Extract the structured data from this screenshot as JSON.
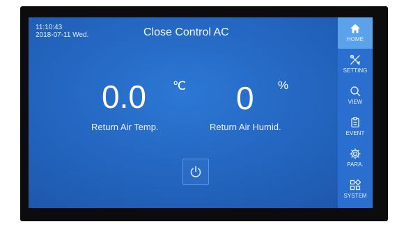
{
  "header": {
    "time": "11:10:43",
    "date": "2018-07-11 Wed.",
    "title": "Close Control AC"
  },
  "readings": {
    "temperature": {
      "value": "0.0",
      "unit": "℃",
      "label": "Return Air Temp."
    },
    "humidity": {
      "value": "0",
      "unit": "%",
      "label": "Return Air Humid."
    }
  },
  "power": {
    "icon": "power-icon"
  },
  "sidebar": {
    "active": "HOME",
    "items": [
      {
        "label": "HOME",
        "icon": "home-icon"
      },
      {
        "label": "SETTING",
        "icon": "tools-icon"
      },
      {
        "label": "VIEW",
        "icon": "search-icon"
      },
      {
        "label": "EVENT",
        "icon": "clipboard-icon"
      },
      {
        "label": "PARA.",
        "icon": "gear-icon"
      },
      {
        "label": "SYSTEM",
        "icon": "grid-icon"
      }
    ]
  },
  "colors": {
    "screen_bg": "#2467c2",
    "sidebar_bg": "#2a6fcf",
    "active_tab": "#5aa3ea",
    "bezel": "#0c0c0f"
  }
}
